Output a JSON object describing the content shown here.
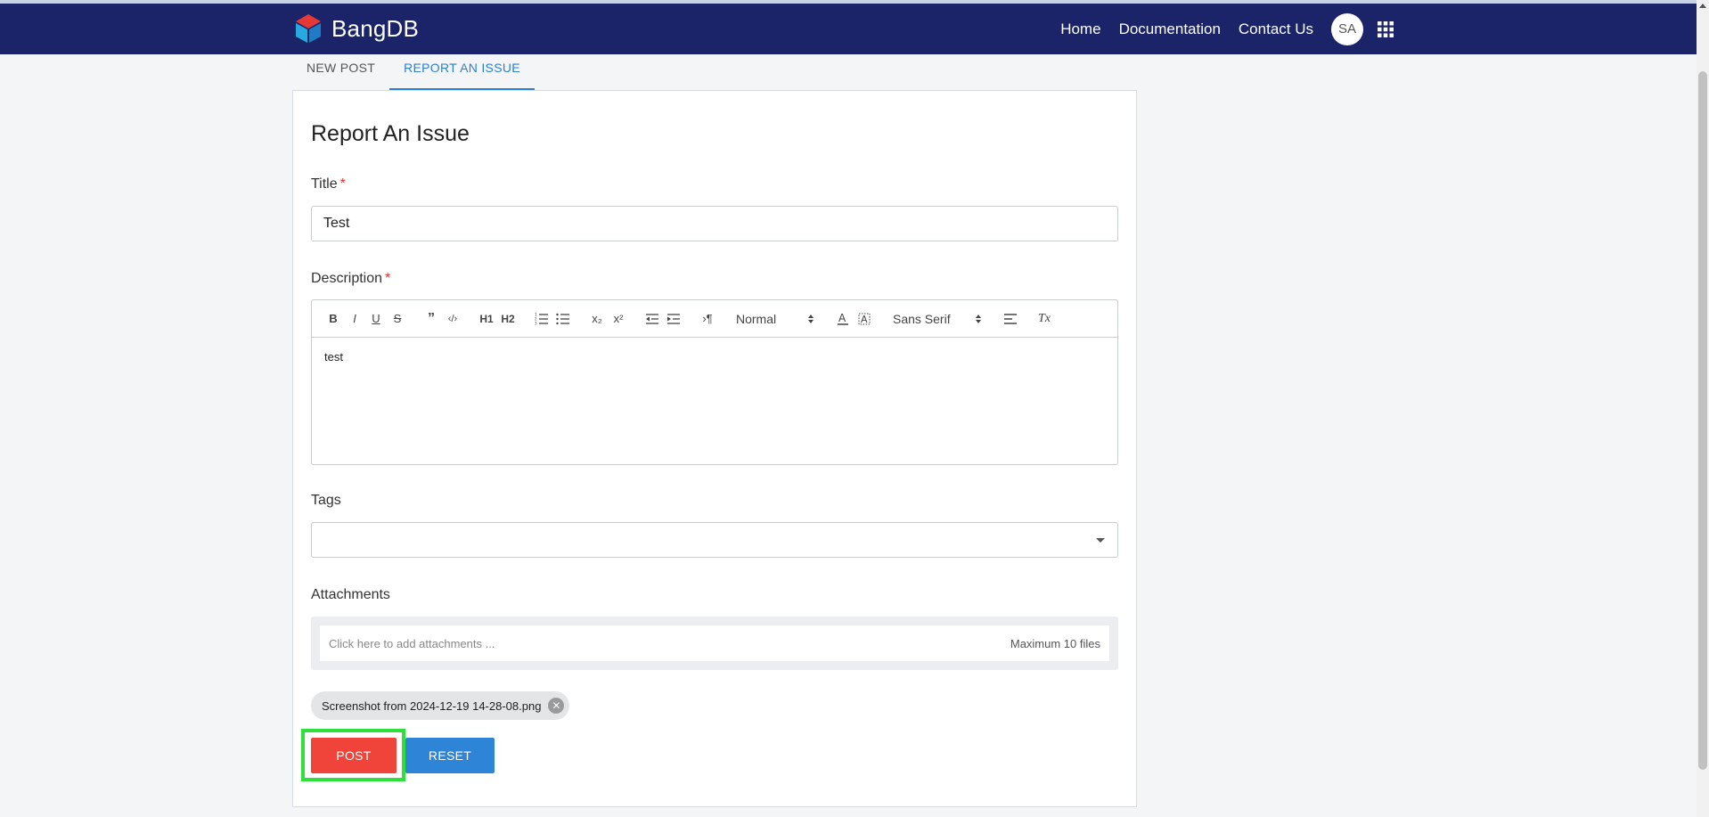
{
  "header": {
    "logo_text": "BangDB",
    "nav": [
      "Home",
      "Documentation",
      "Contact Us"
    ],
    "avatar_initials": "SA",
    "brand_color": "#1b2469"
  },
  "tabs": [
    {
      "label": "NEW POST",
      "active": false
    },
    {
      "label": "REPORT AN ISSUE",
      "active": true
    }
  ],
  "form": {
    "heading": "Report An Issue",
    "title_label": "Title",
    "title_value": "Test",
    "required_mark": "*",
    "description_label": "Description",
    "toolbar": {
      "bold": "B",
      "italic": "I",
      "underline": "U",
      "strike": "S",
      "quote": "”",
      "code": "‹/›",
      "h1": "H1",
      "h2": "H2",
      "subscript": "x₂",
      "superscript": "x²",
      "direction": "›¶",
      "size_select": "Normal",
      "font_select": "Sans Serif",
      "clean": "Tx"
    },
    "description_value": "test",
    "tags_label": "Tags",
    "attachments_label": "Attachments",
    "attachments_placeholder": "Click here to add attachments ...",
    "attachments_max": "Maximum 10 files",
    "attached_file": "Screenshot from 2024-12-19 14-28-08.png",
    "post_label": "POST",
    "reset_label": "RESET"
  }
}
